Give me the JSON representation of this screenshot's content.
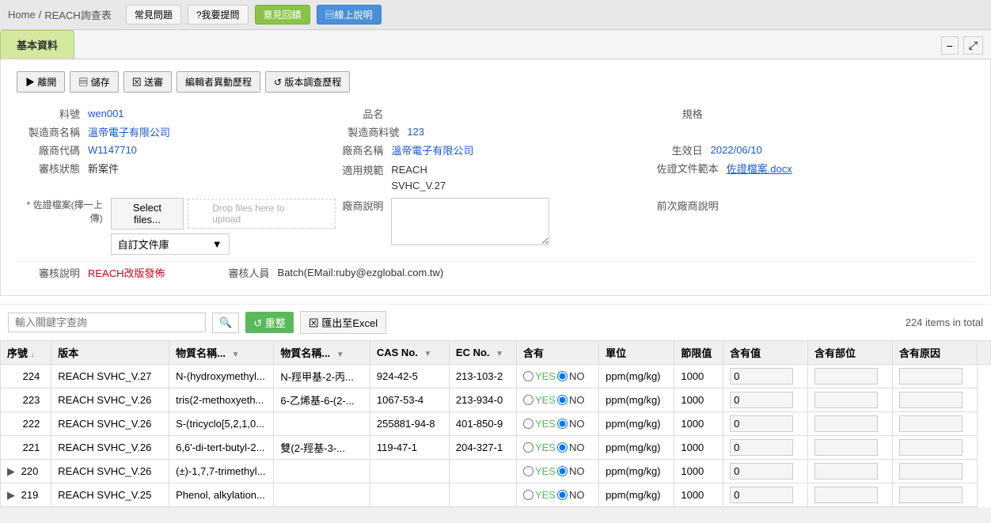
{
  "nav": {
    "home": "Home",
    "separator": "/",
    "current": "REACH詢查表",
    "buttons": [
      {
        "label": "常見問題",
        "type": "default"
      },
      {
        "label": "?我要提問",
        "type": "default"
      },
      {
        "label": "意見回饋",
        "type": "green"
      },
      {
        "label": "▤線上說明",
        "type": "blue"
      }
    ]
  },
  "tab": {
    "label": "基本資料",
    "minimize": "−",
    "maximize": "⤢"
  },
  "toolbar": {
    "buttons": [
      {
        "label": "▶ 離開",
        "name": "leave"
      },
      {
        "label": "▤ 儲存",
        "name": "save"
      },
      {
        "label": "⊠ 送審",
        "name": "submit"
      },
      {
        "label": "編輯者異動歷程",
        "name": "edit-history"
      },
      {
        "label": "↺ 版本調查歷程",
        "name": "version-history"
      }
    ]
  },
  "form": {
    "fields": {
      "料號_label": "料號",
      "料號_value": "wen001",
      "品名_label": "品名",
      "品名_value": "",
      "規格_label": "規格",
      "規格_value": "",
      "製造商名稱_label": "製造商名稱",
      "製造商名稱_value": "溫帝電子有限公司",
      "製造商料號_label": "製造商料號",
      "製造商料號_value": "123",
      "廠商代碼_label": "廠商代碼",
      "廠商代碼_value": "W1147710",
      "廠商名稱_label": "廠商名稱",
      "廠商名稱_value": "溫帝電子有限公司",
      "生效日_label": "生效日",
      "生效日_value": "2022/06/10",
      "審核狀態_label": "審核狀態",
      "審核狀態_value": "新案件",
      "適用規範_label": "適用規範",
      "適用規範_value": "REACH\nSHVC_V.27",
      "佐證文件範本_label": "佐證文件範本",
      "佐證文件範本_value": "佐證檔案.docx",
      "佐證檔案_label": "* 佐證檔案(擇一上傳)",
      "select_files_btn": "Select files...",
      "drop_placeholder": "Drop files here to upload",
      "custom_lib_label": "自訂文件庫",
      "廠商說明_label": "廠商說明",
      "前次廠商說明_label": "前次廠商說明",
      "審核說明_label": "審核說明",
      "審核說明_value": "REACH改版發佈",
      "審核人員_label": "審核人員",
      "審核人員_value": "Batch(EMail:ruby@ezglobal.com.tw)"
    }
  },
  "search": {
    "placeholder": "輸入關鍵字查詢",
    "reset_btn": "↺ 重整",
    "export_btn": "⊠ 匯出至Excel",
    "total": "224 items in total"
  },
  "table": {
    "columns": [
      {
        "key": "seq",
        "label": "序號",
        "sort": true,
        "filter": false
      },
      {
        "key": "version",
        "label": "版本",
        "sort": false,
        "filter": false
      },
      {
        "key": "substance_en",
        "label": "物質名稱...",
        "sort": false,
        "filter": true
      },
      {
        "key": "substance_zh",
        "label": "物質名稱...",
        "sort": false,
        "filter": true
      },
      {
        "key": "cas_no",
        "label": "CAS No.",
        "sort": false,
        "filter": true
      },
      {
        "key": "ec_no",
        "label": "EC No.",
        "sort": false,
        "filter": true
      },
      {
        "key": "contains",
        "label": "含有",
        "sort": false,
        "filter": false
      },
      {
        "key": "unit",
        "label": "單位",
        "sort": false,
        "filter": false
      },
      {
        "key": "limit",
        "label": "節限值",
        "sort": false,
        "filter": false
      },
      {
        "key": "amount",
        "label": "含有值",
        "sort": false,
        "filter": false
      },
      {
        "key": "part",
        "label": "含有部位",
        "sort": false,
        "filter": false
      },
      {
        "key": "reason",
        "label": "含有原因",
        "sort": false,
        "filter": false
      }
    ],
    "rows": [
      {
        "seq": "224",
        "version": "REACH SVHC_V.27",
        "substance_en": "N-(hydroxymethyl...",
        "substance_zh": "N-羥甲基-2-丙...",
        "cas_no": "924-42-5",
        "ec_no": "213-103-2",
        "yes": "YES",
        "no": "NO",
        "unit": "ppm(mg/kg)",
        "limit": "1000",
        "amount": "0",
        "part": "",
        "reason": "",
        "expand": false
      },
      {
        "seq": "223",
        "version": "REACH SVHC_V.26",
        "substance_en": "tris(2-methoxyeth...",
        "substance_zh": "6-乙烯基-6-(2-...",
        "cas_no": "1067-53-4",
        "ec_no": "213-934-0",
        "yes": "YES",
        "no": "NO",
        "unit": "ppm(mg/kg)",
        "limit": "1000",
        "amount": "0",
        "part": "",
        "reason": "",
        "expand": false
      },
      {
        "seq": "222",
        "version": "REACH SVHC_V.26",
        "substance_en": "S-(tricyclo[5,2,1,0...",
        "substance_zh": "",
        "cas_no": "255881-94-8",
        "ec_no": "401-850-9",
        "yes": "YES",
        "no": "NO",
        "unit": "ppm(mg/kg)",
        "limit": "1000",
        "amount": "0",
        "part": "",
        "reason": "",
        "expand": false
      },
      {
        "seq": "221",
        "version": "REACH SVHC_V.26",
        "substance_en": "6,6'-di-tert-butyl-2...",
        "substance_zh": "雙(2-羥基-3-...",
        "cas_no": "119-47-1",
        "ec_no": "204-327-1",
        "yes": "YES",
        "no": "NO",
        "unit": "ppm(mg/kg)",
        "limit": "1000",
        "amount": "0",
        "part": "",
        "reason": "",
        "expand": false
      },
      {
        "seq": "220",
        "version": "REACH SVHC_V.26",
        "substance_en": "(±)-1,7,7-trimethyl...",
        "substance_zh": "",
        "cas_no": "",
        "ec_no": "",
        "yes": "YES",
        "no": "NO",
        "unit": "ppm(mg/kg)",
        "limit": "1000",
        "amount": "0",
        "part": "",
        "reason": "",
        "expand": true
      },
      {
        "seq": "219",
        "version": "REACH SVHC_V.25",
        "substance_en": "Phenol, alkylation...",
        "substance_zh": "",
        "cas_no": "",
        "ec_no": "",
        "yes": "YES",
        "no": "NO",
        "unit": "ppm(mg/kg)",
        "limit": "1000",
        "amount": "0",
        "part": "",
        "reason": "",
        "expand": true
      }
    ]
  }
}
